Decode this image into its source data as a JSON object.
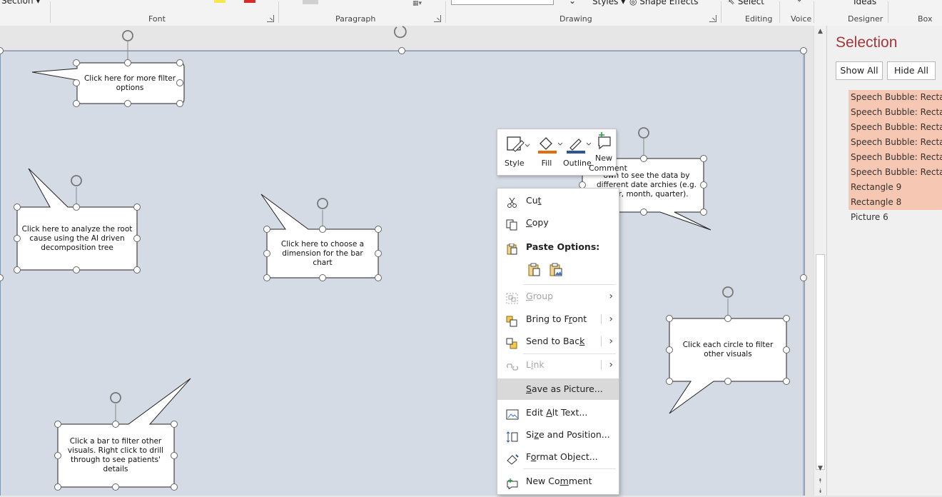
{
  "ribbon": {
    "section_label": "Section",
    "groups": {
      "font": "Font",
      "paragraph": "Paragraph",
      "drawing": "Drawing",
      "editing": "Editing",
      "voice": "Voice",
      "designer": "Designer",
      "box": "Box"
    },
    "styles_label": "Styles",
    "shape_effects_label": "Shape Effects",
    "select_label": "Select",
    "ideas_label": "Ideas"
  },
  "bubbles": [
    {
      "text": "Click here for more filter options"
    },
    {
      "text": "Click here to analyze the root cause using the AI driven decomposition tree"
    },
    {
      "text": "Click here to choose a dimension for the bar chart"
    },
    {
      "text": "own to see the data by different date archies (e.g. year, month, quarter)."
    },
    {
      "text": "Click each circle to filter other visuals"
    },
    {
      "text": "Click a bar to filter other visuals. Right click to drill through to see patients' details"
    }
  ],
  "mini_toolbar": {
    "style": "Style",
    "fill": "Fill",
    "outline": "Outline",
    "new_comment_1": "New",
    "new_comment_2": "Comment"
  },
  "context_menu": {
    "cut": "Cut",
    "copy": "Copy",
    "paste_options": "Paste Options:",
    "group": "Group",
    "bring_to_front": "Bring to Front",
    "send_to_back": "Send to Back",
    "link": "Link",
    "save_as_picture": "Save as Picture...",
    "edit_alt_text": "Edit Alt Text...",
    "size_and_position": "Size and Position...",
    "format_object": "Format Object...",
    "new_comment": "New Comment"
  },
  "selection_pane": {
    "title": "Selection",
    "show_all": "Show All",
    "hide_all": "Hide All",
    "items": [
      {
        "label": "Speech Bubble: Rectangle",
        "selected": true
      },
      {
        "label": "Speech Bubble: Rectangle",
        "selected": true
      },
      {
        "label": "Speech Bubble: Rectangle",
        "selected": true
      },
      {
        "label": "Speech Bubble: Rectangle",
        "selected": true
      },
      {
        "label": "Speech Bubble: Rectangle",
        "selected": true
      },
      {
        "label": "Speech Bubble: Rectangle",
        "selected": true
      },
      {
        "label": "Rectangle 9",
        "selected": true
      },
      {
        "label": "Rectangle 8",
        "selected": true
      },
      {
        "label": "Picture 6",
        "selected": false
      }
    ]
  },
  "colors": {
    "title": "#a5373a",
    "selected_item": "#f6c7b2",
    "slide_bg": "#d5dbe5",
    "menu_hover": "#d9d9d9"
  }
}
